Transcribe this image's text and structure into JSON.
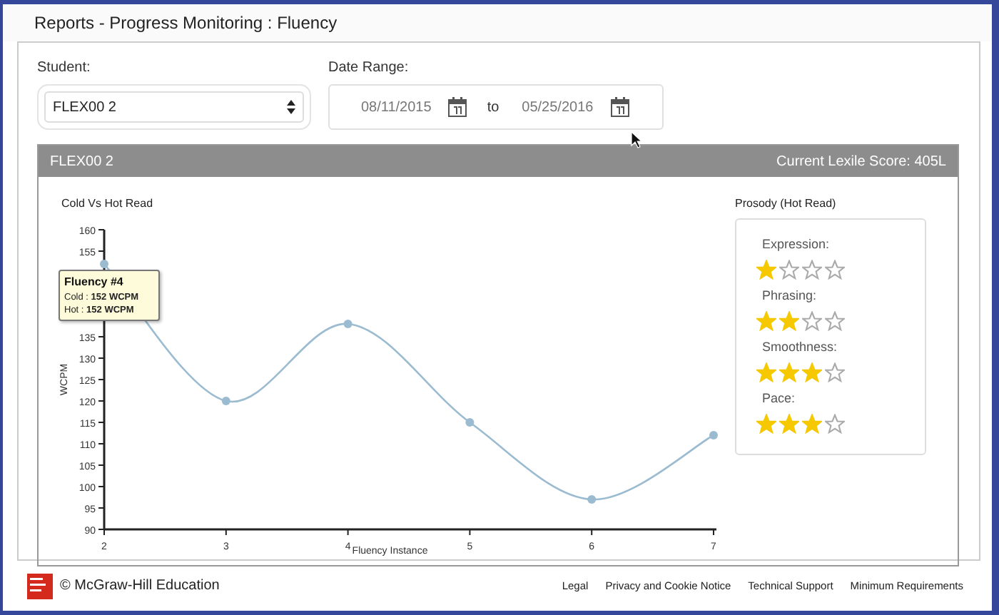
{
  "page_title": "Reports - Progress Monitoring : Fluency",
  "filters": {
    "student": {
      "label": "Student:",
      "value": "FLEX00 2"
    },
    "date_range": {
      "label": "Date Range:",
      "from": "08/11/2015",
      "separator": "to",
      "to": "05/25/2016"
    }
  },
  "report": {
    "student_name": "FLEX00 2",
    "lexile": "Current Lexile Score: 405L",
    "chart_data": {
      "type": "line",
      "title": "Cold Vs Hot Read",
      "xlabel": "Fluency Instance",
      "ylabel": "WCPM",
      "x": [
        2,
        3,
        4,
        5,
        6,
        7
      ],
      "series": [
        {
          "color": "#9bbbd0",
          "marker": "circle",
          "values": [
            152,
            120,
            138,
            115,
            97,
            112
          ]
        }
      ],
      "xlim": [
        2,
        7
      ],
      "ylim": [
        90,
        160
      ],
      "xticks": [
        2,
        3,
        4,
        5,
        6,
        7
      ],
      "yticks": [
        90,
        95,
        100,
        105,
        110,
        115,
        120,
        125,
        130,
        135,
        155,
        160
      ]
    },
    "tooltip": {
      "title": "Fluency #4",
      "lines": [
        "Cold : **152 WCPM**",
        "Hot : **152 WCPM**"
      ]
    },
    "prosody": {
      "title": "Prosody (Hot Read)",
      "items": [
        {
          "label": "Expression:",
          "stars": 1
        },
        {
          "label": "Phrasing:",
          "stars": 2
        },
        {
          "label": "Smoothness:",
          "stars": 3
        },
        {
          "label": "Pace:",
          "stars": 3
        }
      ]
    }
  },
  "footer": {
    "copyright": "© McGraw-Hill Education",
    "links": [
      "Legal",
      "Privacy and Cookie Notice",
      "Technical Support",
      "Minimum Requirements"
    ]
  }
}
